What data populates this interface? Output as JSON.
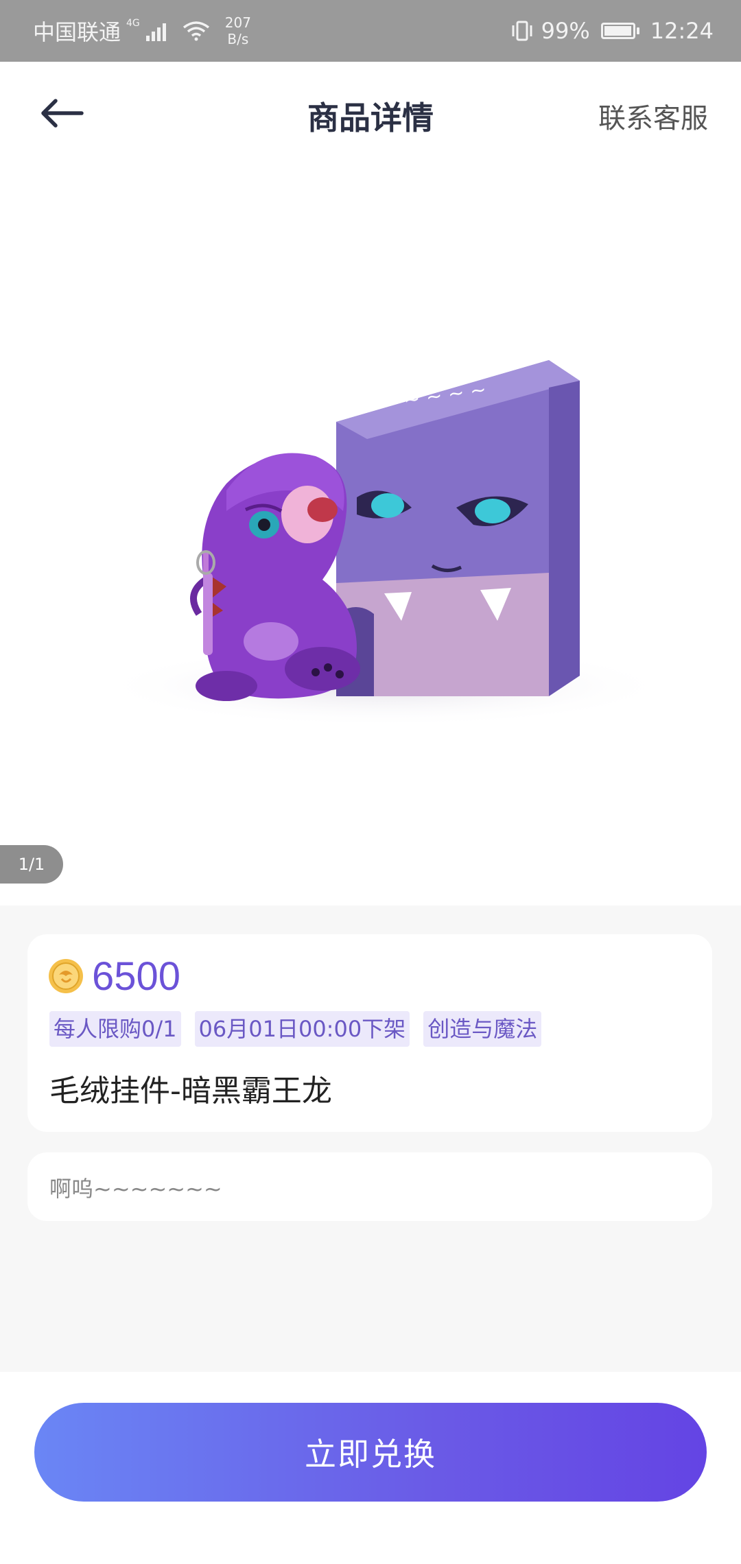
{
  "status_bar": {
    "carrier": "中国联通",
    "network": "4G",
    "speed_value": "207",
    "speed_unit": "B/s",
    "battery": "99%",
    "time": "12:24"
  },
  "header": {
    "title": "商品详情",
    "contact": "联系客服"
  },
  "gallery": {
    "counter": "1/1"
  },
  "product": {
    "price": "6500",
    "tags": [
      "每人限购0/1",
      "06月01日00:00下架",
      "创造与魔法"
    ],
    "name": "毛绒挂件-暗黑霸王龙",
    "description": "啊呜~~~~~~~"
  },
  "action": {
    "exchange_label": "立即兑换"
  },
  "colors": {
    "accent": "#6b52d8",
    "button_start": "#6a86f5",
    "button_end": "#6444e4",
    "status_bar": "#9a9a9a"
  }
}
